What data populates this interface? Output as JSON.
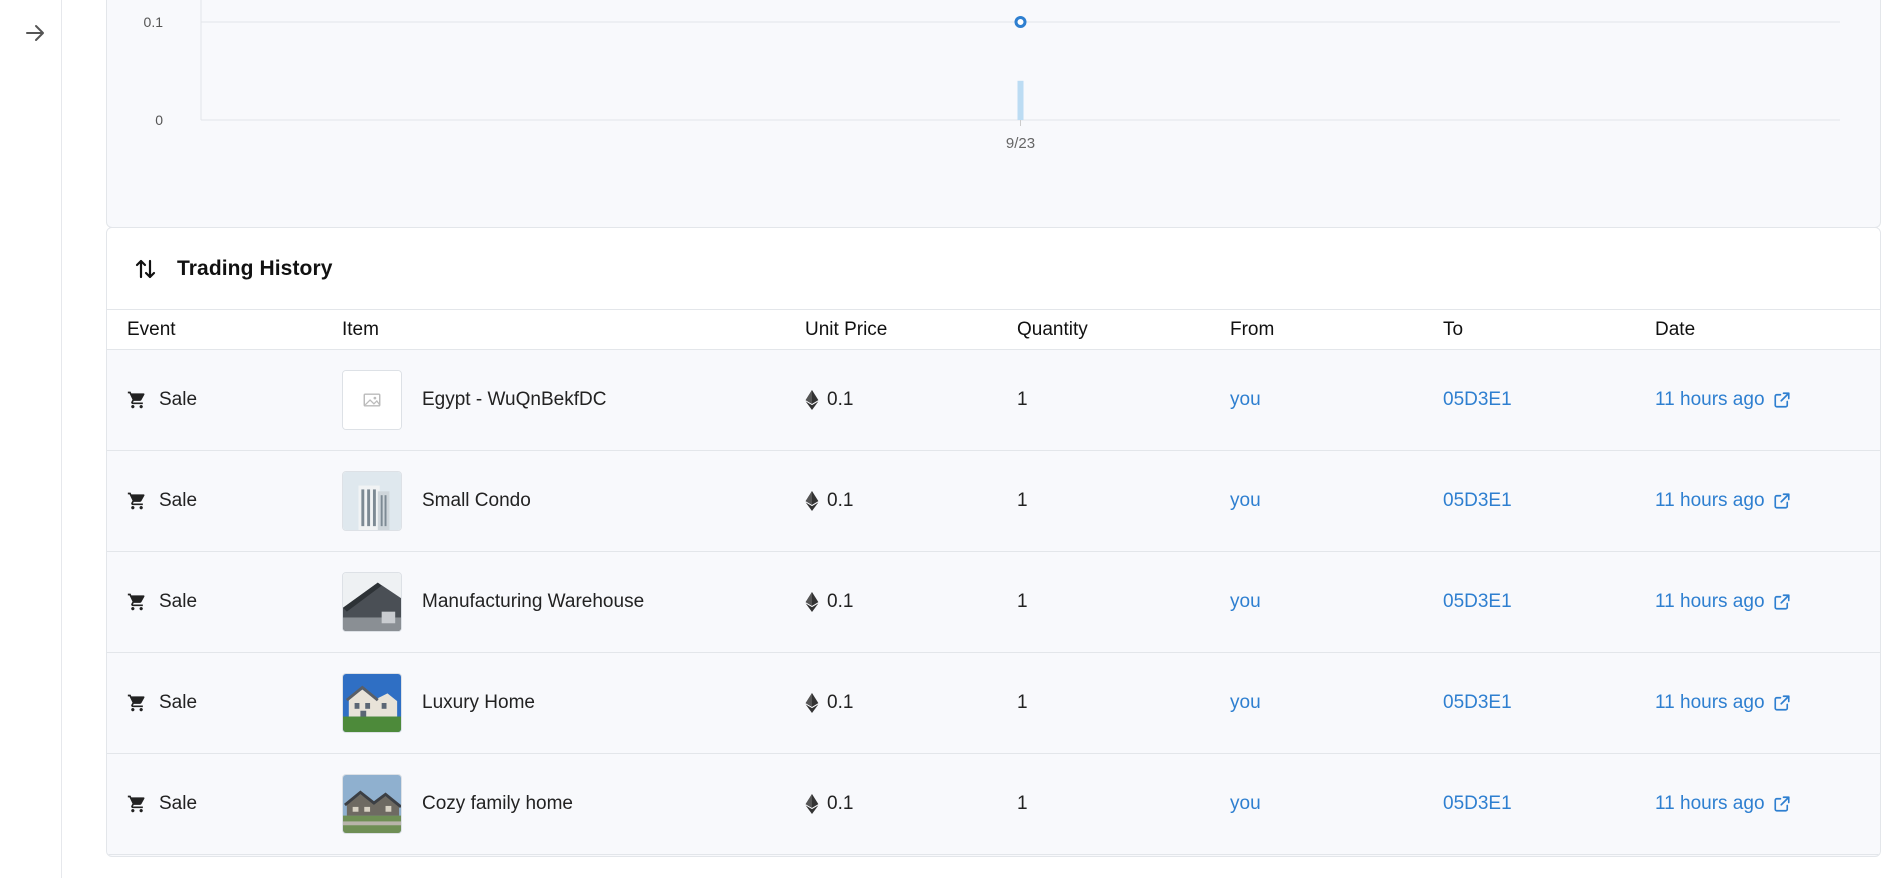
{
  "sidebar": {
    "expand_icon": "arrow-right-icon"
  },
  "chart_data": {
    "type": "line",
    "x": [
      "9/23"
    ],
    "series": [
      {
        "values": [
          0.1
        ]
      }
    ],
    "volume": [
      0.05
    ],
    "yticks": [
      "0.1",
      "0"
    ],
    "xticks": [
      "9/23"
    ],
    "ylim": [
      0,
      0.1
    ],
    "grid": true
  },
  "history": {
    "title": "Trading History",
    "icon": "swap-vertical-icon",
    "columns": {
      "event": "Event",
      "item": "Item",
      "unit_price": "Unit Price",
      "quantity": "Quantity",
      "from": "From",
      "to": "To",
      "date": "Date"
    },
    "rows": [
      {
        "event": "Sale",
        "item": "Egypt - WuQnBekfDC",
        "thumb": "placeholder",
        "price": "0.1",
        "quantity": "1",
        "from": "you",
        "to": "05D3E1",
        "date": "11 hours ago"
      },
      {
        "event": "Sale",
        "item": "Small Condo",
        "thumb": "condo",
        "price": "0.1",
        "quantity": "1",
        "from": "you",
        "to": "05D3E1",
        "date": "11 hours ago"
      },
      {
        "event": "Sale",
        "item": "Manufacturing Warehouse",
        "thumb": "warehouse",
        "price": "0.1",
        "quantity": "1",
        "from": "you",
        "to": "05D3E1",
        "date": "11 hours ago"
      },
      {
        "event": "Sale",
        "item": "Luxury Home",
        "thumb": "luxury",
        "price": "0.1",
        "quantity": "1",
        "from": "you",
        "to": "05D3E1",
        "date": "11 hours ago"
      },
      {
        "event": "Sale",
        "item": "Cozy family home",
        "thumb": "cozy",
        "price": "0.1",
        "quantity": "1",
        "from": "you",
        "to": "05D3E1",
        "date": "11 hours ago"
      }
    ]
  },
  "colors": {
    "link": "#2e7fd0",
    "line_point": "#2e7fd0",
    "volume_bar": "#bcdcf3"
  }
}
